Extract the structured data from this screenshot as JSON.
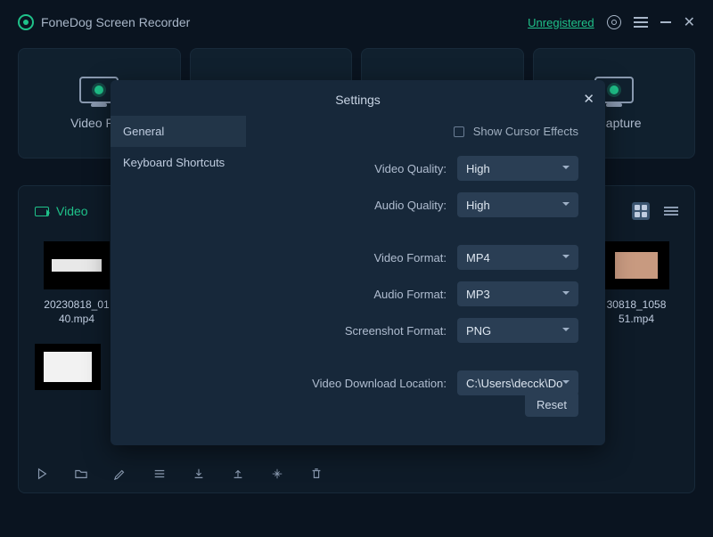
{
  "app_title": "FoneDog Screen Recorder",
  "unregistered": "Unregistered",
  "modes": {
    "video": "Video Rec",
    "capture": "n Capture"
  },
  "library": {
    "video_tab": "Video",
    "thumbs": [
      {
        "label": "20230818_01\n40.mp4"
      },
      {
        "label": "30818_1058\n51.mp4"
      }
    ]
  },
  "settings": {
    "title": "Settings",
    "nav": {
      "general": "General",
      "shortcuts": "Keyboard Shortcuts"
    },
    "cursor_effects": "Show Cursor Effects",
    "labels": {
      "video_quality": "Video Quality:",
      "audio_quality": "Audio Quality:",
      "video_format": "Video Format:",
      "audio_format": "Audio Format:",
      "screenshot_format": "Screenshot Format:",
      "download_location": "Video Download Location:"
    },
    "values": {
      "video_quality": "High",
      "audio_quality": "High",
      "video_format": "MP4",
      "audio_format": "MP3",
      "screenshot_format": "PNG",
      "download_location": "C:\\Users\\decck\\Do"
    },
    "reset": "Reset"
  }
}
